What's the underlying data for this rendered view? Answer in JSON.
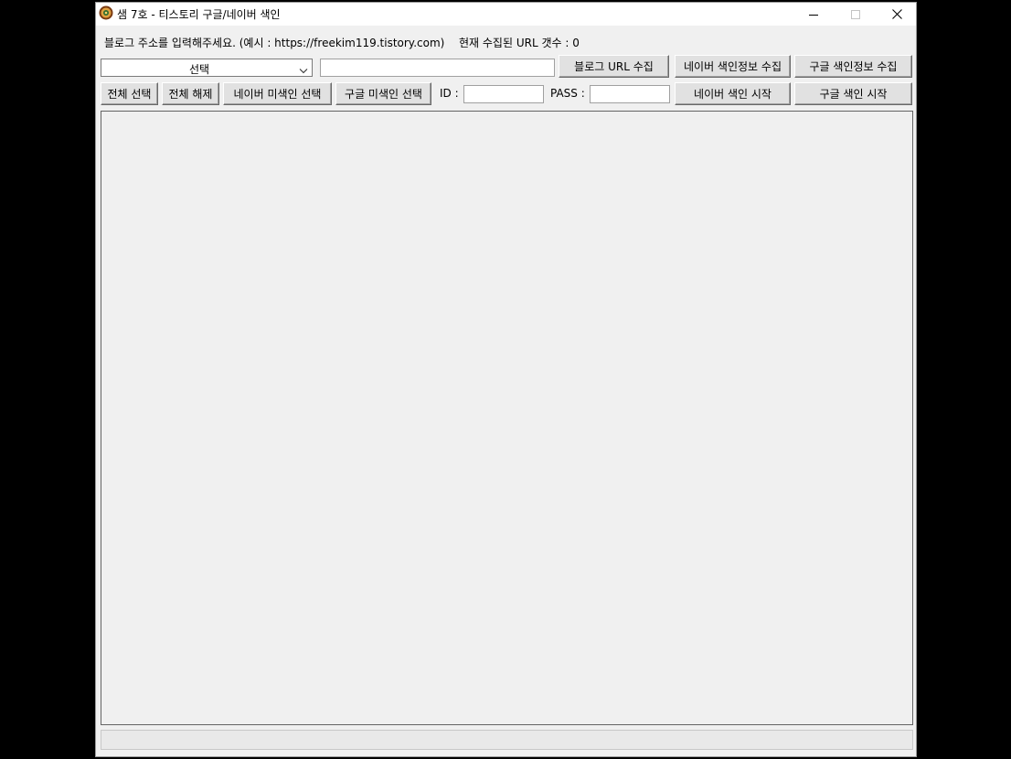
{
  "window": {
    "title": "샘 7호 - 티스토리 구글/네이버 색인"
  },
  "info": {
    "blog_hint": "블로그 주소를 입력해주세요. (예시 : https://freekim119.tistory.com)",
    "url_count_label": "현재 수집된 URL 갯수 : 0"
  },
  "row1": {
    "select_value": "선택",
    "url_input_value": "",
    "collect_blog_url": "블로그 URL 수집",
    "collect_naver_index": "네이버 색인정보 수집",
    "collect_google_index": "구글 색인정보 수집"
  },
  "row2": {
    "select_all": "전체 선택",
    "deselect_all": "전체 해제",
    "select_naver_unindexed": "네이버 미색인 선택",
    "select_google_unindexed": "구글 미색인 선택",
    "id_label": "ID :",
    "id_value": "",
    "pass_label": "PASS :",
    "pass_value": "",
    "start_naver_index": "네이버 색인 시작",
    "start_google_index": "구글 색인 시작"
  },
  "colors": {
    "window_bg": "#f0f0f0",
    "button_bg": "#e1e1e1",
    "desktop_bg": "#000000"
  },
  "icons": {
    "app": "app-emblem-icon",
    "minimize": "minimize-icon",
    "maximize": "maximize-icon",
    "close": "close-icon",
    "dropdown": "chevron-down-icon"
  }
}
